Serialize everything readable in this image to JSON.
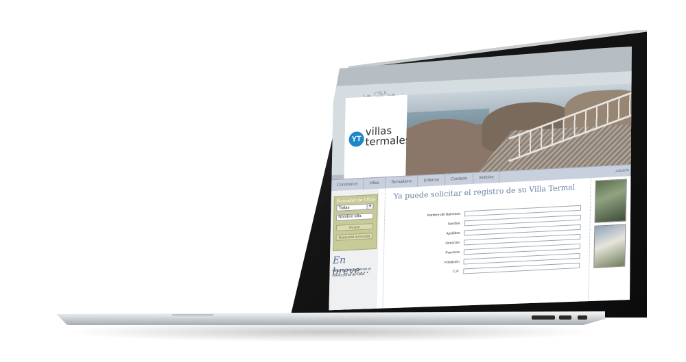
{
  "site": {
    "logo": {
      "mark": "YT",
      "line1": "villas",
      "line2": "termales"
    },
    "nav": {
      "items": [
        "Conócenos",
        "Villas",
        "Termalismo",
        "Enfermo",
        "Contacto",
        "Noticias"
      ],
      "user_label": "usuario"
    },
    "search": {
      "title": "Buscador de Villas",
      "select_value": "Todas",
      "name_placeholder": "Nombre villa",
      "search_button": "Buscar",
      "advanced_button": "Búsqueda avanzada"
    },
    "news": {
      "heading": "En breve...",
      "text": "Estamos construyendo el nuevo portal de villas"
    },
    "form": {
      "title": "Ya puede solicitar el registro de su Villa Termal",
      "fields": [
        "Nombre del Balneario",
        "Nombre",
        "Apellidos",
        "Dirección",
        "Provincia",
        "Población",
        "C.P."
      ]
    }
  },
  "colors": {
    "accent_blue": "#1d87c9",
    "form_title": "#6b84a3",
    "search_box": "#c8ca98"
  }
}
